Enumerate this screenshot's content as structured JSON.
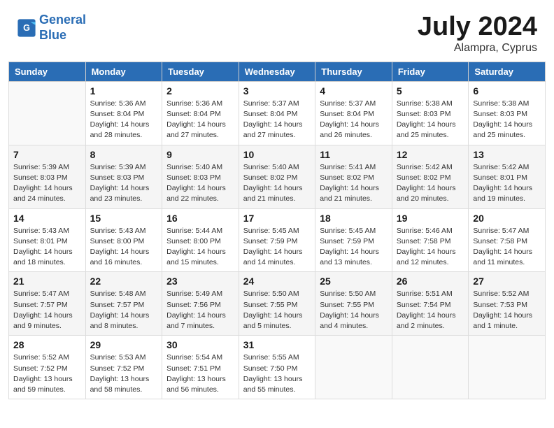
{
  "header": {
    "logo_line1": "General",
    "logo_line2": "Blue",
    "month": "July 2024",
    "location": "Alampra, Cyprus"
  },
  "days_of_week": [
    "Sunday",
    "Monday",
    "Tuesday",
    "Wednesday",
    "Thursday",
    "Friday",
    "Saturday"
  ],
  "weeks": [
    [
      {
        "day": "",
        "info": ""
      },
      {
        "day": "1",
        "info": "Sunrise: 5:36 AM\nSunset: 8:04 PM\nDaylight: 14 hours\nand 28 minutes."
      },
      {
        "day": "2",
        "info": "Sunrise: 5:36 AM\nSunset: 8:04 PM\nDaylight: 14 hours\nand 27 minutes."
      },
      {
        "day": "3",
        "info": "Sunrise: 5:37 AM\nSunset: 8:04 PM\nDaylight: 14 hours\nand 27 minutes."
      },
      {
        "day": "4",
        "info": "Sunrise: 5:37 AM\nSunset: 8:04 PM\nDaylight: 14 hours\nand 26 minutes."
      },
      {
        "day": "5",
        "info": "Sunrise: 5:38 AM\nSunset: 8:03 PM\nDaylight: 14 hours\nand 25 minutes."
      },
      {
        "day": "6",
        "info": "Sunrise: 5:38 AM\nSunset: 8:03 PM\nDaylight: 14 hours\nand 25 minutes."
      }
    ],
    [
      {
        "day": "7",
        "info": "Sunrise: 5:39 AM\nSunset: 8:03 PM\nDaylight: 14 hours\nand 24 minutes."
      },
      {
        "day": "8",
        "info": "Sunrise: 5:39 AM\nSunset: 8:03 PM\nDaylight: 14 hours\nand 23 minutes."
      },
      {
        "day": "9",
        "info": "Sunrise: 5:40 AM\nSunset: 8:03 PM\nDaylight: 14 hours\nand 22 minutes."
      },
      {
        "day": "10",
        "info": "Sunrise: 5:40 AM\nSunset: 8:02 PM\nDaylight: 14 hours\nand 21 minutes."
      },
      {
        "day": "11",
        "info": "Sunrise: 5:41 AM\nSunset: 8:02 PM\nDaylight: 14 hours\nand 21 minutes."
      },
      {
        "day": "12",
        "info": "Sunrise: 5:42 AM\nSunset: 8:02 PM\nDaylight: 14 hours\nand 20 minutes."
      },
      {
        "day": "13",
        "info": "Sunrise: 5:42 AM\nSunset: 8:01 PM\nDaylight: 14 hours\nand 19 minutes."
      }
    ],
    [
      {
        "day": "14",
        "info": "Sunrise: 5:43 AM\nSunset: 8:01 PM\nDaylight: 14 hours\nand 18 minutes."
      },
      {
        "day": "15",
        "info": "Sunrise: 5:43 AM\nSunset: 8:00 PM\nDaylight: 14 hours\nand 16 minutes."
      },
      {
        "day": "16",
        "info": "Sunrise: 5:44 AM\nSunset: 8:00 PM\nDaylight: 14 hours\nand 15 minutes."
      },
      {
        "day": "17",
        "info": "Sunrise: 5:45 AM\nSunset: 7:59 PM\nDaylight: 14 hours\nand 14 minutes."
      },
      {
        "day": "18",
        "info": "Sunrise: 5:45 AM\nSunset: 7:59 PM\nDaylight: 14 hours\nand 13 minutes."
      },
      {
        "day": "19",
        "info": "Sunrise: 5:46 AM\nSunset: 7:58 PM\nDaylight: 14 hours\nand 12 minutes."
      },
      {
        "day": "20",
        "info": "Sunrise: 5:47 AM\nSunset: 7:58 PM\nDaylight: 14 hours\nand 11 minutes."
      }
    ],
    [
      {
        "day": "21",
        "info": "Sunrise: 5:47 AM\nSunset: 7:57 PM\nDaylight: 14 hours\nand 9 minutes."
      },
      {
        "day": "22",
        "info": "Sunrise: 5:48 AM\nSunset: 7:57 PM\nDaylight: 14 hours\nand 8 minutes."
      },
      {
        "day": "23",
        "info": "Sunrise: 5:49 AM\nSunset: 7:56 PM\nDaylight: 14 hours\nand 7 minutes."
      },
      {
        "day": "24",
        "info": "Sunrise: 5:50 AM\nSunset: 7:55 PM\nDaylight: 14 hours\nand 5 minutes."
      },
      {
        "day": "25",
        "info": "Sunrise: 5:50 AM\nSunset: 7:55 PM\nDaylight: 14 hours\nand 4 minutes."
      },
      {
        "day": "26",
        "info": "Sunrise: 5:51 AM\nSunset: 7:54 PM\nDaylight: 14 hours\nand 2 minutes."
      },
      {
        "day": "27",
        "info": "Sunrise: 5:52 AM\nSunset: 7:53 PM\nDaylight: 14 hours\nand 1 minute."
      }
    ],
    [
      {
        "day": "28",
        "info": "Sunrise: 5:52 AM\nSunset: 7:52 PM\nDaylight: 13 hours\nand 59 minutes."
      },
      {
        "day": "29",
        "info": "Sunrise: 5:53 AM\nSunset: 7:52 PM\nDaylight: 13 hours\nand 58 minutes."
      },
      {
        "day": "30",
        "info": "Sunrise: 5:54 AM\nSunset: 7:51 PM\nDaylight: 13 hours\nand 56 minutes."
      },
      {
        "day": "31",
        "info": "Sunrise: 5:55 AM\nSunset: 7:50 PM\nDaylight: 13 hours\nand 55 minutes."
      },
      {
        "day": "",
        "info": ""
      },
      {
        "day": "",
        "info": ""
      },
      {
        "day": "",
        "info": ""
      }
    ]
  ]
}
